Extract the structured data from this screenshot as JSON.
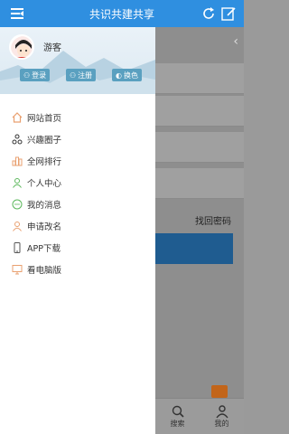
{
  "topbar": {
    "title": "共识共建共享"
  },
  "drawer": {
    "username": "游客",
    "buttons": [
      {
        "label": "登录",
        "icon": "user-icon"
      },
      {
        "label": "注册",
        "icon": "user-add-icon"
      },
      {
        "label": "换色",
        "icon": "palette-icon"
      }
    ],
    "menu": [
      {
        "label": "网站首页",
        "icon": "home-icon",
        "color": "#e9a070"
      },
      {
        "label": "兴趣圈子",
        "icon": "circle-group-icon",
        "color": "#333333"
      },
      {
        "label": "全网排行",
        "icon": "ranking-icon",
        "color": "#e9a070"
      },
      {
        "label": "个人中心",
        "icon": "user-icon",
        "color": "#5cb85c"
      },
      {
        "label": "我的消息",
        "icon": "message-icon",
        "color": "#5cb85c"
      },
      {
        "label": "申请改名",
        "icon": "rename-icon",
        "color": "#e9a070"
      },
      {
        "label": "APP下载",
        "icon": "phone-icon",
        "color": "#555555"
      },
      {
        "label": "看电脑版",
        "icon": "monitor-icon",
        "color": "#e9a070"
      }
    ]
  },
  "background_page": {
    "forgot_password": "找回密码"
  },
  "bottom_nav": {
    "search": "搜索",
    "mine": "我的"
  }
}
